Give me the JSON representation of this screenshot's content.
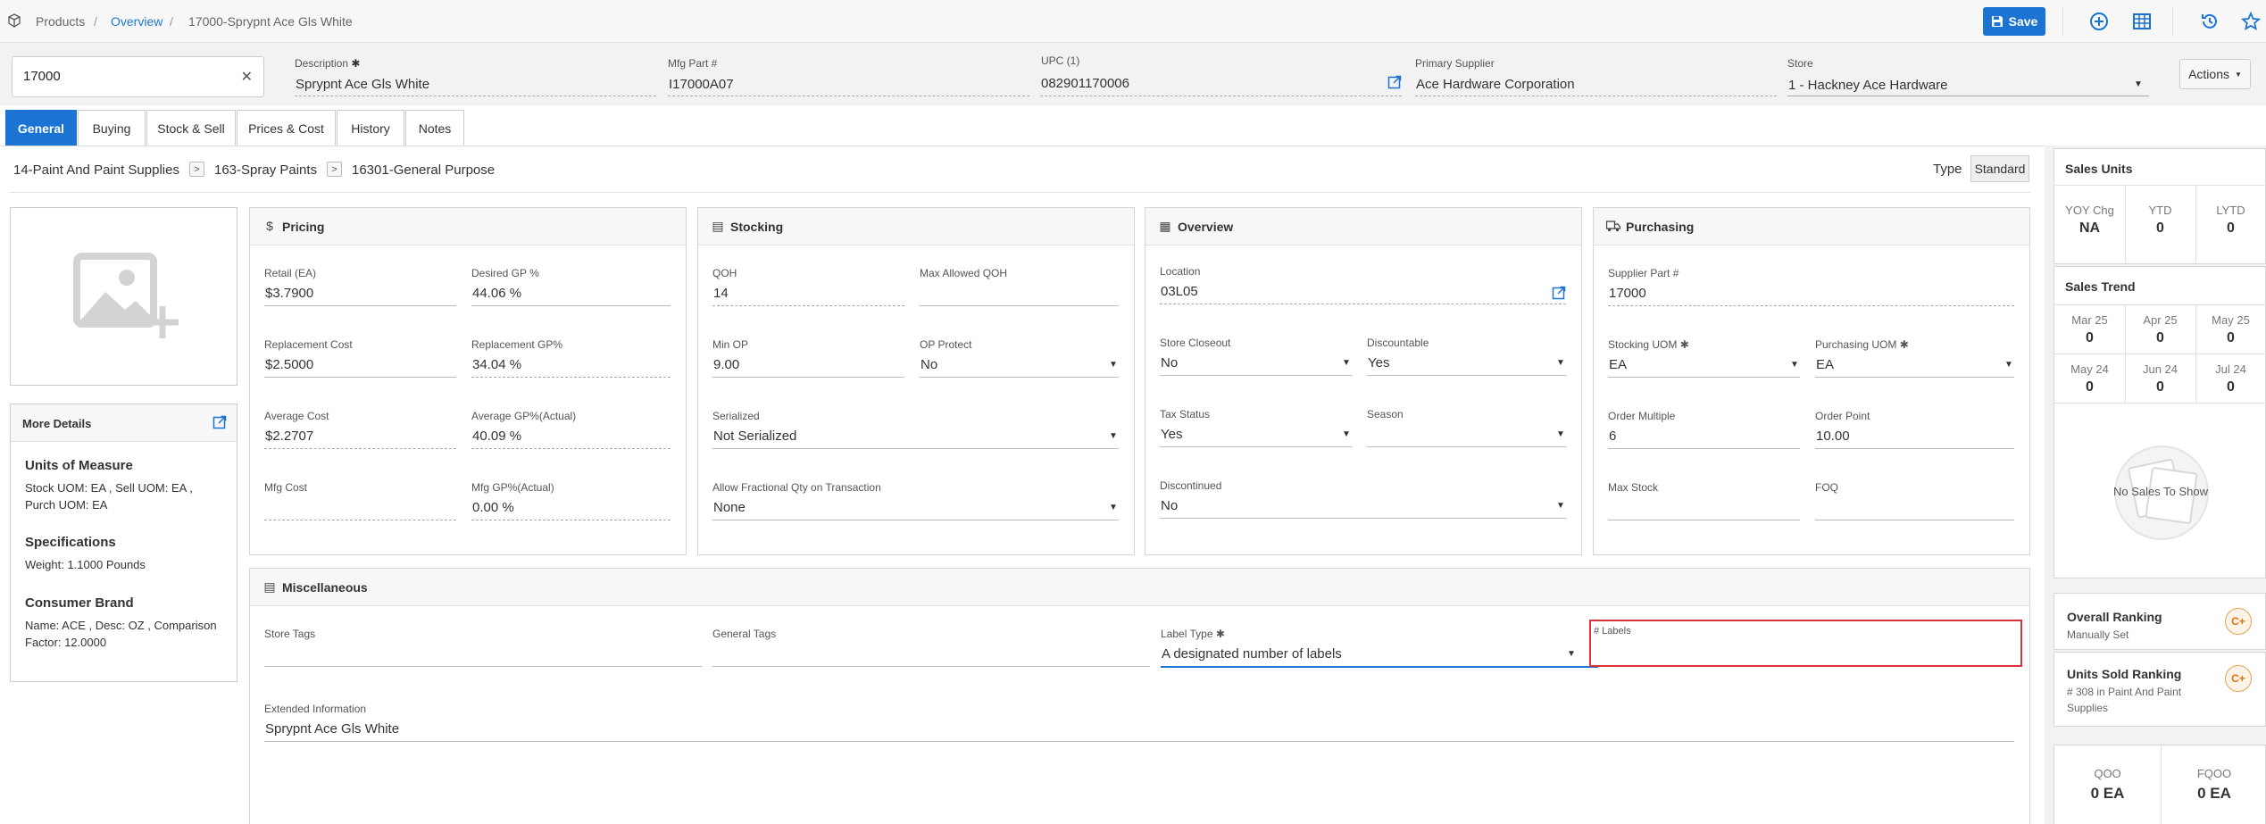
{
  "breadcrumb": {
    "root": "Products",
    "link": "Overview",
    "current": "17000-Sprypnt Ace Gls White",
    "sep": "/"
  },
  "toolbar": {
    "save_label": "Save"
  },
  "header": {
    "search_value": "17000",
    "clear_glyph": "✕",
    "description_label": "Description",
    "description_value": "Sprypnt Ace Gls White",
    "mfg_part_label": "Mfg Part #",
    "mfg_part_value": "I17000A07",
    "upc_label": "UPC (1)",
    "upc_value": "082901170006",
    "supplier_label": "Primary Supplier",
    "supplier_value": "Ace Hardware Corporation",
    "store_label": "Store",
    "store_value": "1 - Hackney Ace Hardware",
    "actions_label": "Actions",
    "required_mark": "✱"
  },
  "tabs": [
    "General",
    "Buying",
    "Stock & Sell",
    "Prices & Cost",
    "History",
    "Notes"
  ],
  "category": {
    "level1": "14-Paint And Paint Supplies",
    "level2": "163-Spray Paints",
    "level3": "16301-General Purpose",
    "arrow": ">"
  },
  "type": {
    "label": "Type",
    "value": "Standard"
  },
  "more_details": {
    "title": "More Details",
    "uom_heading": "Units of Measure",
    "uom_line1": "Stock UOM: EA , Sell UOM: EA ,",
    "uom_line2": "Purch UOM: EA",
    "spec_heading": "Specifications",
    "spec_line": "Weight: 1.1000 Pounds",
    "brand_heading": "Consumer Brand",
    "brand_line1": "Name: ACE , Desc: OZ , Comparison",
    "brand_line2": "Factor: 12.0000"
  },
  "pricing": {
    "title": "Pricing",
    "retail_label": "Retail (EA)",
    "retail_value": "$3.7900",
    "desired_gp_label": "Desired GP %",
    "desired_gp_value": "44.06 %",
    "repl_cost_label": "Replacement Cost",
    "repl_cost_value": "$2.5000",
    "repl_gp_label": "Replacement GP%",
    "repl_gp_value": "34.04 %",
    "avg_cost_label": "Average Cost",
    "avg_cost_value": "$2.2707",
    "avg_gp_label": "Average GP%(Actual)",
    "avg_gp_value": "40.09 %",
    "mfg_cost_label": "Mfg Cost",
    "mfg_cost_value": "",
    "mfg_gp_label": "Mfg GP%(Actual)",
    "mfg_gp_value": "0.00 %"
  },
  "stocking": {
    "title": "Stocking",
    "qoh_label": "QOH",
    "qoh_value": "14",
    "max_qoh_label": "Max Allowed QOH",
    "max_qoh_value": "",
    "min_op_label": "Min OP",
    "min_op_value": "9.00",
    "op_protect_label": "OP Protect",
    "op_protect_value": "No",
    "serialized_label": "Serialized",
    "serialized_value": "Not Serialized",
    "fractional_label": "Allow Fractional Qty on Transaction",
    "fractional_value": "None"
  },
  "overview": {
    "title": "Overview",
    "location_label": "Location",
    "location_value": "03L05",
    "closeout_label": "Store Closeout",
    "closeout_value": "No",
    "discountable_label": "Discountable",
    "discountable_value": "Yes",
    "tax_label": "Tax Status",
    "tax_value": "Yes",
    "season_label": "Season",
    "season_value": "",
    "discontinued_label": "Discontinued",
    "discontinued_value": "No"
  },
  "purchasing": {
    "title": "Purchasing",
    "supplier_part_label": "Supplier Part #",
    "supplier_part_value": "17000",
    "stocking_uom_label": "Stocking UOM",
    "stocking_uom_value": "EA",
    "purchasing_uom_label": "Purchasing UOM",
    "purchasing_uom_value": "EA",
    "order_multiple_label": "Order Multiple",
    "order_multiple_value": "6",
    "order_point_label": "Order Point",
    "order_point_value": "10.00",
    "max_stock_label": "Max Stock",
    "max_stock_value": "",
    "fqo_label": "FOQ",
    "fqo_value": ""
  },
  "misc": {
    "title": "Miscellaneous",
    "store_tags_label": "Store Tags",
    "general_tags_label": "General Tags",
    "label_type_label": "Label Type",
    "label_type_value": "A designated number of labels",
    "num_labels_label": "# Labels",
    "num_labels_value": "",
    "extended_label": "Extended Information",
    "extended_value": "Sprypnt Ace Gls White"
  },
  "sales_units": {
    "title": "Sales Units",
    "stats": [
      {
        "label": "YOY Chg",
        "value": "NA"
      },
      {
        "label": "YTD",
        "value": "0"
      },
      {
        "label": "LYTD",
        "value": "0"
      }
    ]
  },
  "sales_trend": {
    "title": "Sales Trend",
    "months": [
      {
        "label": "Mar 25",
        "value": "0"
      },
      {
        "label": "Apr 25",
        "value": "0"
      },
      {
        "label": "May 25",
        "value": "0"
      },
      {
        "label": "May 24",
        "value": "0"
      },
      {
        "label": "Jun 24",
        "value": "0"
      },
      {
        "label": "Jul 24",
        "value": "0"
      }
    ],
    "empty_text": "No Sales To Show"
  },
  "rankings": {
    "overall_title": "Overall Ranking",
    "overall_sub": "Manually Set",
    "overall_grade": "C+",
    "units_title": "Units Sold Ranking",
    "units_sub_line1": "# 308 in Paint And Paint",
    "units_sub_line2": "Supplies",
    "units_grade": "C+"
  },
  "orders": {
    "qoo_label": "QOO",
    "qoo_value": "0 EA",
    "fqoo_label": "FQOO",
    "fqoo_value": "0 EA"
  },
  "colors": {
    "accent": "#1b74d4",
    "highlight": "#d9343b",
    "grade": "#d9730d"
  }
}
